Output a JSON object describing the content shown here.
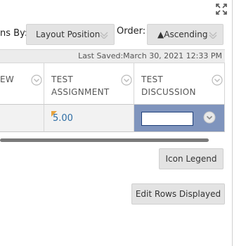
{
  "toolbar": {
    "columns_by_label": "ns By:",
    "columns_by_value": "Layout Position",
    "order_label": "Order:",
    "order_value": "▲Ascending"
  },
  "status": {
    "last_saved": "Last Saved:March 30, 2021 12:33 PM"
  },
  "grid": {
    "columns": [
      {
        "label": "EW"
      },
      {
        "label": "TEST ASSIGNMENT"
      },
      {
        "label": "TEST DISCUSSION"
      }
    ],
    "row": {
      "assignment_grade": "5.00",
      "discussion_grade": ""
    }
  },
  "actions": {
    "icon_legend": "Icon Legend",
    "edit_rows": "Edit Rows Displayed"
  },
  "colors": {
    "accent_selected_cell": "#7f94bd",
    "link_blue": "#2e6da4",
    "flag_orange": "#e8a33d"
  },
  "icons": [
    "expand-icon",
    "chevron-down-icon",
    "column-menu-icon",
    "needs-grading-flag-icon"
  ]
}
